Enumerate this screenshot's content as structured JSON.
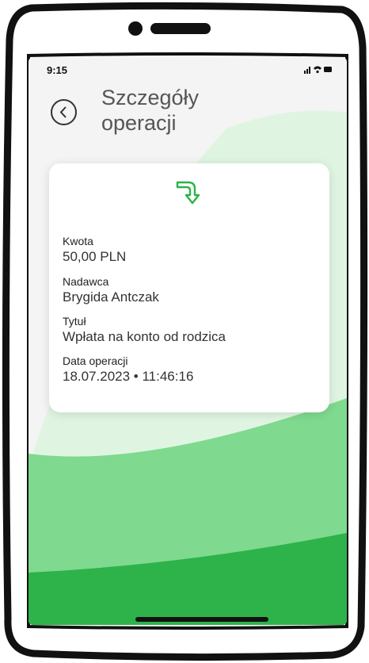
{
  "status_bar": {
    "time": "9:15"
  },
  "header": {
    "title_line1": "Szczegóły",
    "title_line2": "operacji"
  },
  "details": {
    "amount_label": "Kwota",
    "amount_value": "50,00 PLN",
    "sender_label": "Nadawca",
    "sender_value": "Brygida Antczak",
    "title_label": "Tytuł",
    "title_value": "Wpłata na konto od rodzica",
    "date_label": "Data operacji",
    "date_value": "18.07.2023 • 11:46:16"
  },
  "colors": {
    "accent": "#2db34a",
    "light_green": "#7fd98f",
    "text": "#333333"
  },
  "icons": {
    "back": "back-circle-chevron-icon",
    "transfer": "incoming-transfer-arrow-icon"
  }
}
